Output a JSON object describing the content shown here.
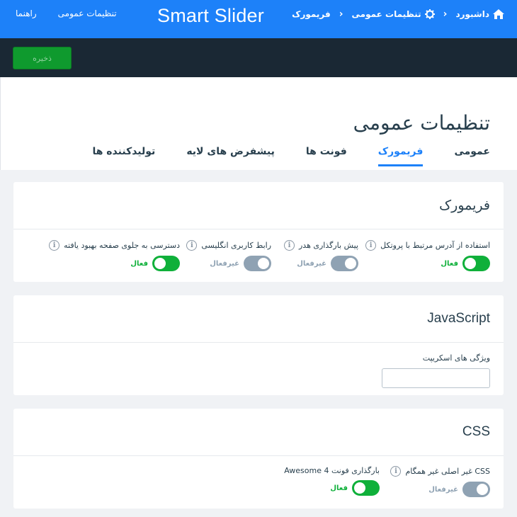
{
  "topbar": {
    "links": [
      "تنظیمات عمومی",
      "راهنما"
    ],
    "logo": "Smart Slider",
    "breadcrumbs": [
      {
        "label": "داشبورد",
        "icon": "home-icon"
      },
      {
        "label": "تنظیمات عمومی",
        "icon": "gear-icon"
      },
      {
        "label": "فریمورک",
        "icon": ""
      }
    ]
  },
  "toolbar": {
    "save_label": "ذخیره"
  },
  "header": {
    "title": "تنظیمات عمومی",
    "tabs": [
      "عمومی",
      "فریمورک",
      "فونت ها",
      "پیشفرض های لایه",
      "تولیدکننده ها"
    ],
    "active_tab": "فریمورک"
  },
  "framework": {
    "title": "فریمورک",
    "fields": [
      {
        "label": "استفاده از آدرس مرتبط با پروتکل",
        "state": "فعال",
        "on": true
      },
      {
        "label": "پیش بارگذاری هدر",
        "state": "غیرفعال",
        "on": false
      },
      {
        "label": "رابط کاربری انگلیسی",
        "state": "غیرفعال",
        "on": false
      },
      {
        "label": "دسترسی به جلوی صفحه بهبود یافته",
        "state": "فعال",
        "on": true
      }
    ]
  },
  "javascript": {
    "title": "JavaScript",
    "script_attr_label": "ویژگی های اسکریپت",
    "script_attr_value": ""
  },
  "css": {
    "title": "CSS",
    "fields": [
      {
        "label": "CSS غیر اصلی غیر همگام",
        "state": "غیرفعال",
        "on": false
      },
      {
        "label": "بارگذاری فونت Awesome 4",
        "state": "فعال",
        "on": true
      }
    ]
  },
  "colors": {
    "accent": "#1d81f9",
    "toolbar": "#1a2834",
    "on": "#0fb03a",
    "off": "#8fa2b3",
    "save": "#0f9a2e"
  }
}
